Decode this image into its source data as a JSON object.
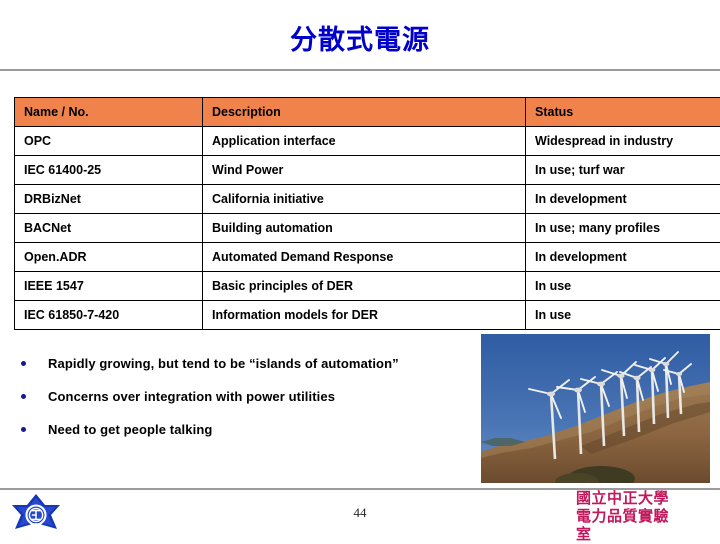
{
  "slide": {
    "title": "分散式電源",
    "page_number": "44",
    "accent_orange": "#F0824C",
    "title_color": "#0000CC",
    "bullet_color": "#151B8D",
    "footer_color": "#C2185B",
    "rule_color": "#9b9b9b"
  },
  "table": {
    "headers": [
      "Name / No.",
      "Description",
      "Status"
    ],
    "rows": [
      [
        "OPC",
        "Application interface",
        "Widespread in industry"
      ],
      [
        "IEC 61400-25",
        "Wind Power",
        "In use; turf war"
      ],
      [
        "DRBizNet",
        "California initiative",
        "In development"
      ],
      [
        "BACNet",
        "Building automation",
        "In use; many profiles"
      ],
      [
        "Open.ADR",
        "Automated Demand Response",
        "In development"
      ],
      [
        "IEEE 1547",
        "Basic principles of DER",
        "In use"
      ],
      [
        "IEC 61850-7-420",
        "Information models for DER",
        "In use"
      ]
    ]
  },
  "bullets": [
    "Rapidly growing, but tend to be “islands of automation”",
    "Concerns over integration with power utilities",
    "Need to get people talking"
  ],
  "photo": {
    "alt": "wind-farm-photo",
    "sky_color": "#3d66a8",
    "hill_color": "#8a6643",
    "turbine_color": "#e8e8e6"
  },
  "footer": {
    "org_line1": "國立中正大學",
    "org_line2": "電力品質實驗",
    "org_line3": "室",
    "logo_alt": "university-emblem"
  }
}
